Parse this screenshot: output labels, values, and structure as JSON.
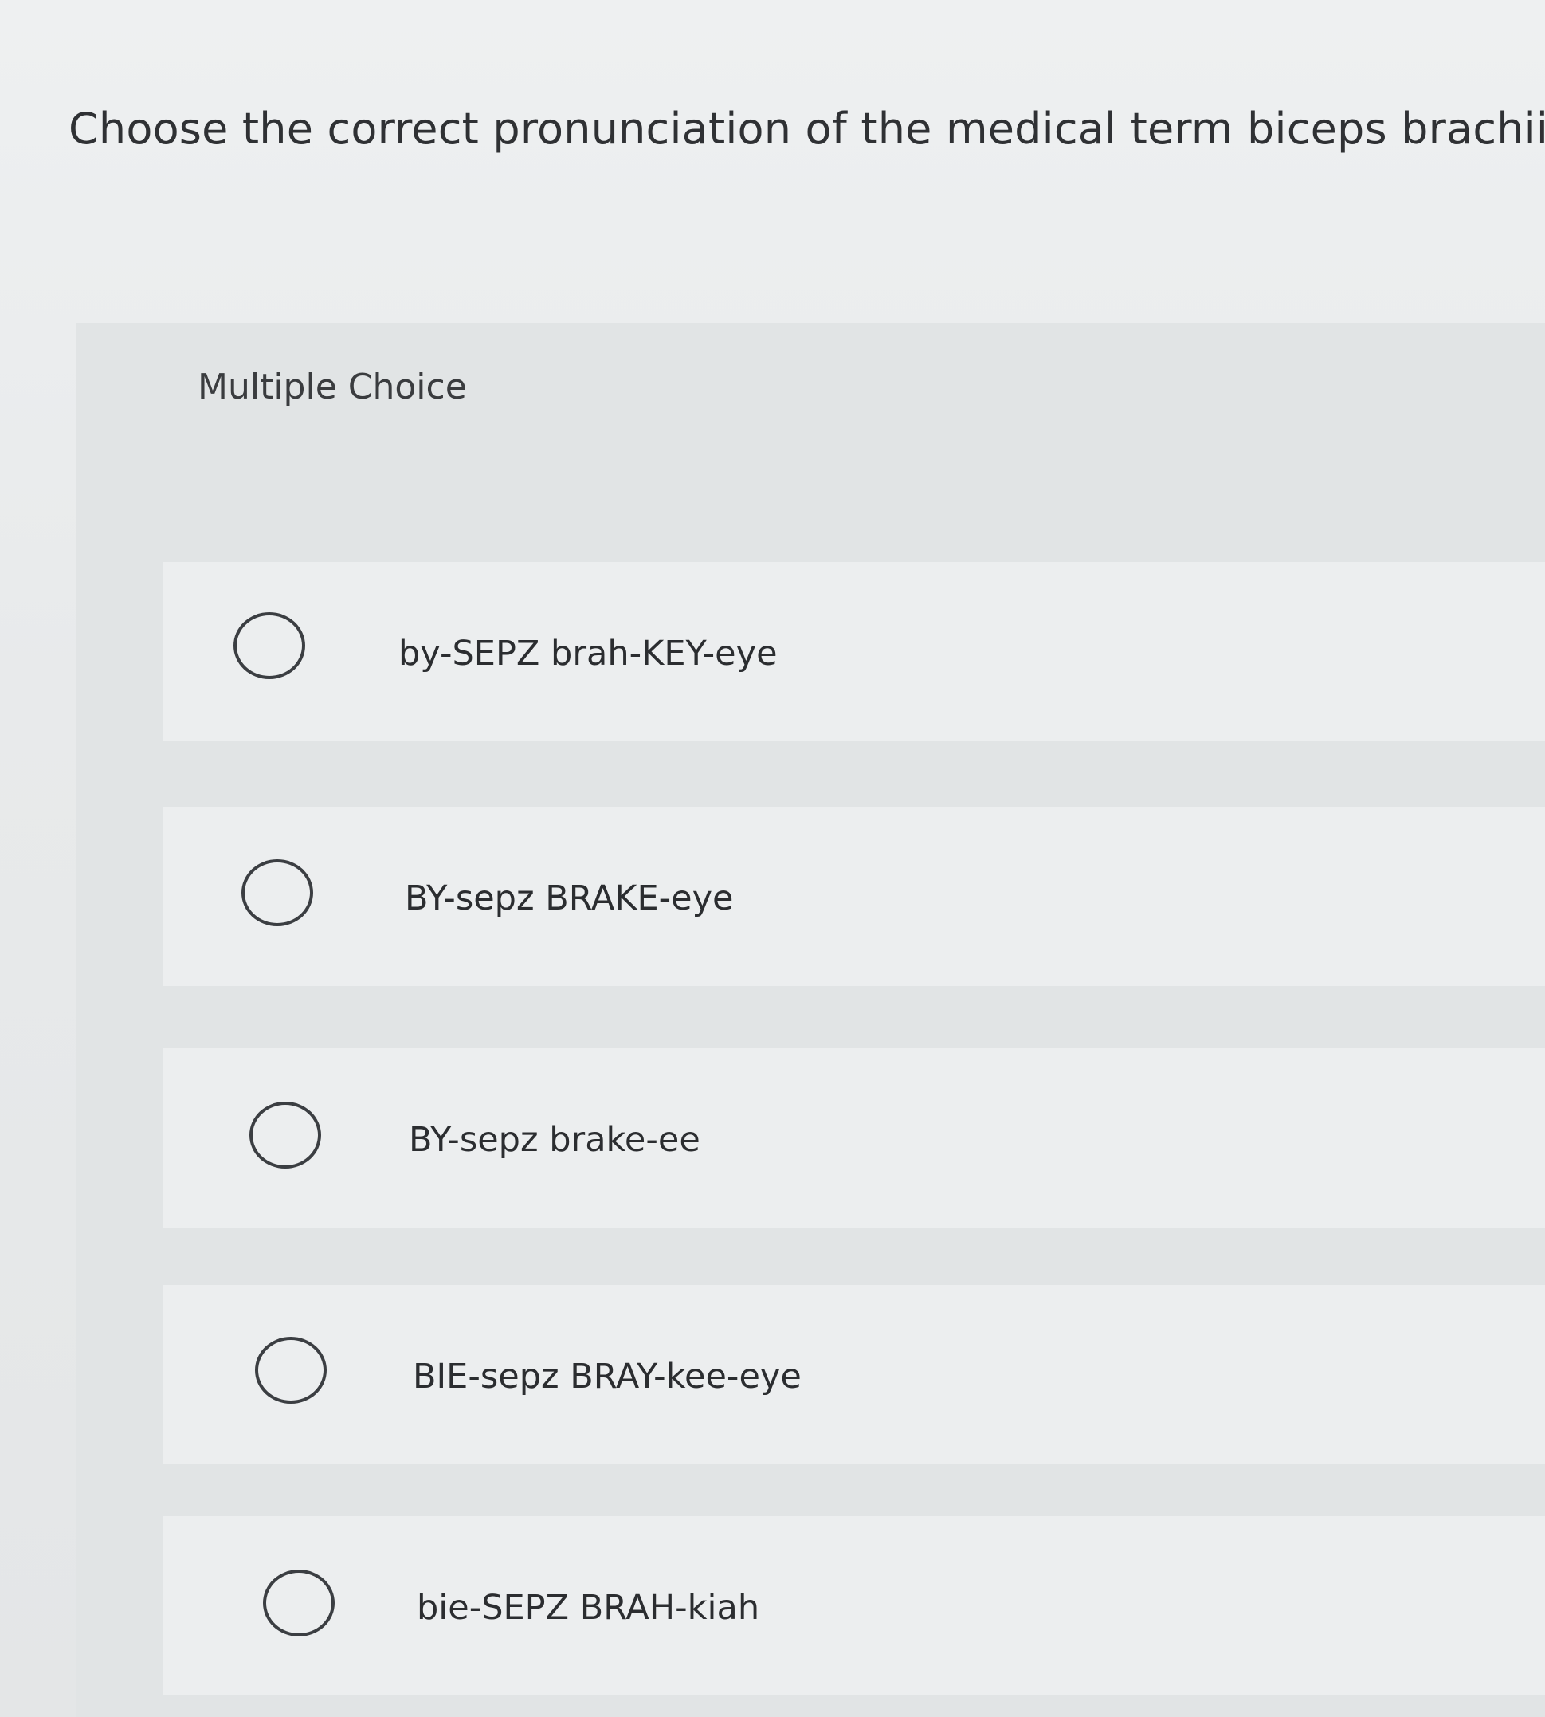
{
  "question": {
    "text": "Choose the correct pronunciation of the medical term biceps brachii."
  },
  "multiple_choice": {
    "header": "Multiple Choice",
    "options": [
      {
        "label": "by-SEPZ brah-KEY-eye",
        "selected": false
      },
      {
        "label": "BY-sepz BRAKE-eye",
        "selected": false
      },
      {
        "label": "BY-sepz brake-ee",
        "selected": false
      },
      {
        "label": "BIE-sepz BRAY-kee-eye",
        "selected": false
      },
      {
        "label": "bie-SEPZ BRAH-kiah",
        "selected": false
      }
    ]
  }
}
